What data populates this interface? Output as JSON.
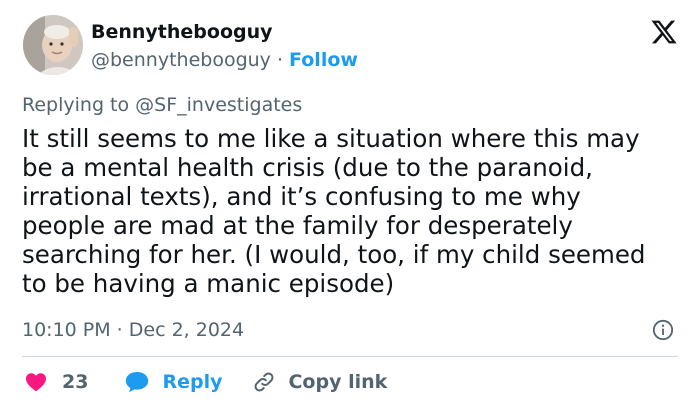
{
  "header": {
    "display_name": "Bennythebooguy",
    "handle": "@bennythebooguy",
    "separator": " · ",
    "follow_label": "Follow"
  },
  "icons": {
    "logo": "x-logo-icon",
    "info": "info-icon",
    "like": "heart-icon",
    "reply": "speech-bubble-icon",
    "copy": "link-icon"
  },
  "colors": {
    "accent": "#1d9bf0",
    "like": "#f91880",
    "secondary_text": "#536471",
    "primary_text": "#0f1419",
    "divider": "#cfd9de"
  },
  "tweet": {
    "replying_to": "Replying to @SF_investigates",
    "text_lines": [
      "It still seems to me like a situation where this may",
      "be a mental health crisis (due to the paranoid,",
      "irrational texts), and it’s confusing to me why",
      "people are mad at the family for desperately",
      "searching for her. (I would, too, if my child seemed",
      "to be having a manic episode)"
    ],
    "timestamp": "10:10 PM · Dec 2, 2024"
  },
  "actions": {
    "like_count": "23",
    "reply_label": "Reply",
    "copy_label": "Copy link"
  }
}
